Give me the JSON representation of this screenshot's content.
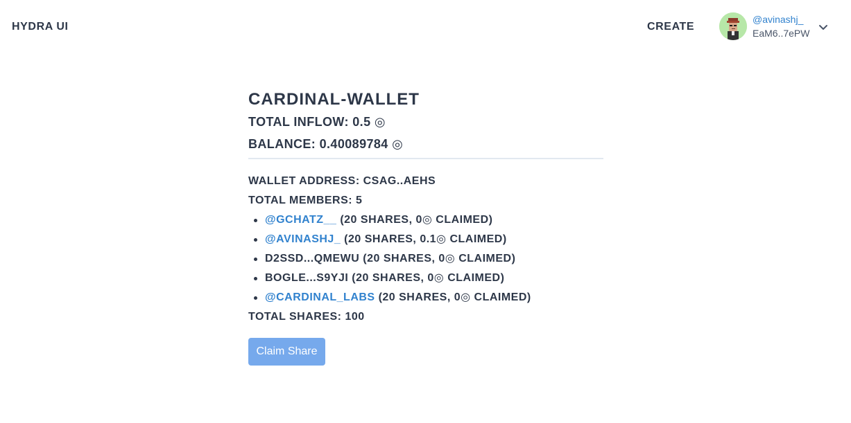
{
  "header": {
    "brand": "HYDRA UI",
    "create_label": "CREATE",
    "account": {
      "handle": "@avinashj_",
      "address": "EaM6..7ePW"
    }
  },
  "wallet": {
    "name": "CARDINAL-WALLET",
    "total_inflow_label": "TOTAL INFLOW:",
    "total_inflow_value": "0.5",
    "balance_label": "BALANCE:",
    "balance_value": "0.40089784",
    "sol_symbol": "◎",
    "address_line": "WALLET ADDRESS: CSAG..AEHS",
    "total_members_line": "TOTAL MEMBERS: 5",
    "members": [
      {
        "name": "@GCHATZ__",
        "detail": " (20 SHARES, 0◎ CLAIMED)",
        "is_link": true
      },
      {
        "name": "@AVINASHJ_",
        "detail": " (20 SHARES, 0.1◎ CLAIMED)",
        "is_link": true
      },
      {
        "name": "D2SSD...QMEWU",
        "detail": " (20 SHARES, 0◎ CLAIMED)",
        "is_link": false
      },
      {
        "name": "BOGLE...S9YJI",
        "detail": " (20 SHARES, 0◎ CLAIMED)",
        "is_link": false
      },
      {
        "name": "@CARDINAL_LABS",
        "detail": " (20 SHARES, 0◎ CLAIMED)",
        "is_link": true
      }
    ],
    "total_shares_line": "TOTAL SHARES: 100",
    "claim_label": "Claim Share"
  },
  "colors": {
    "link": "#3182ce",
    "text": "#2d3748",
    "button_bg": "#76a9ec",
    "avatar_bg": "#b7e7a8"
  },
  "icons": {
    "chevron": "chevron-down-icon",
    "avatar": "pixel-avatar"
  }
}
